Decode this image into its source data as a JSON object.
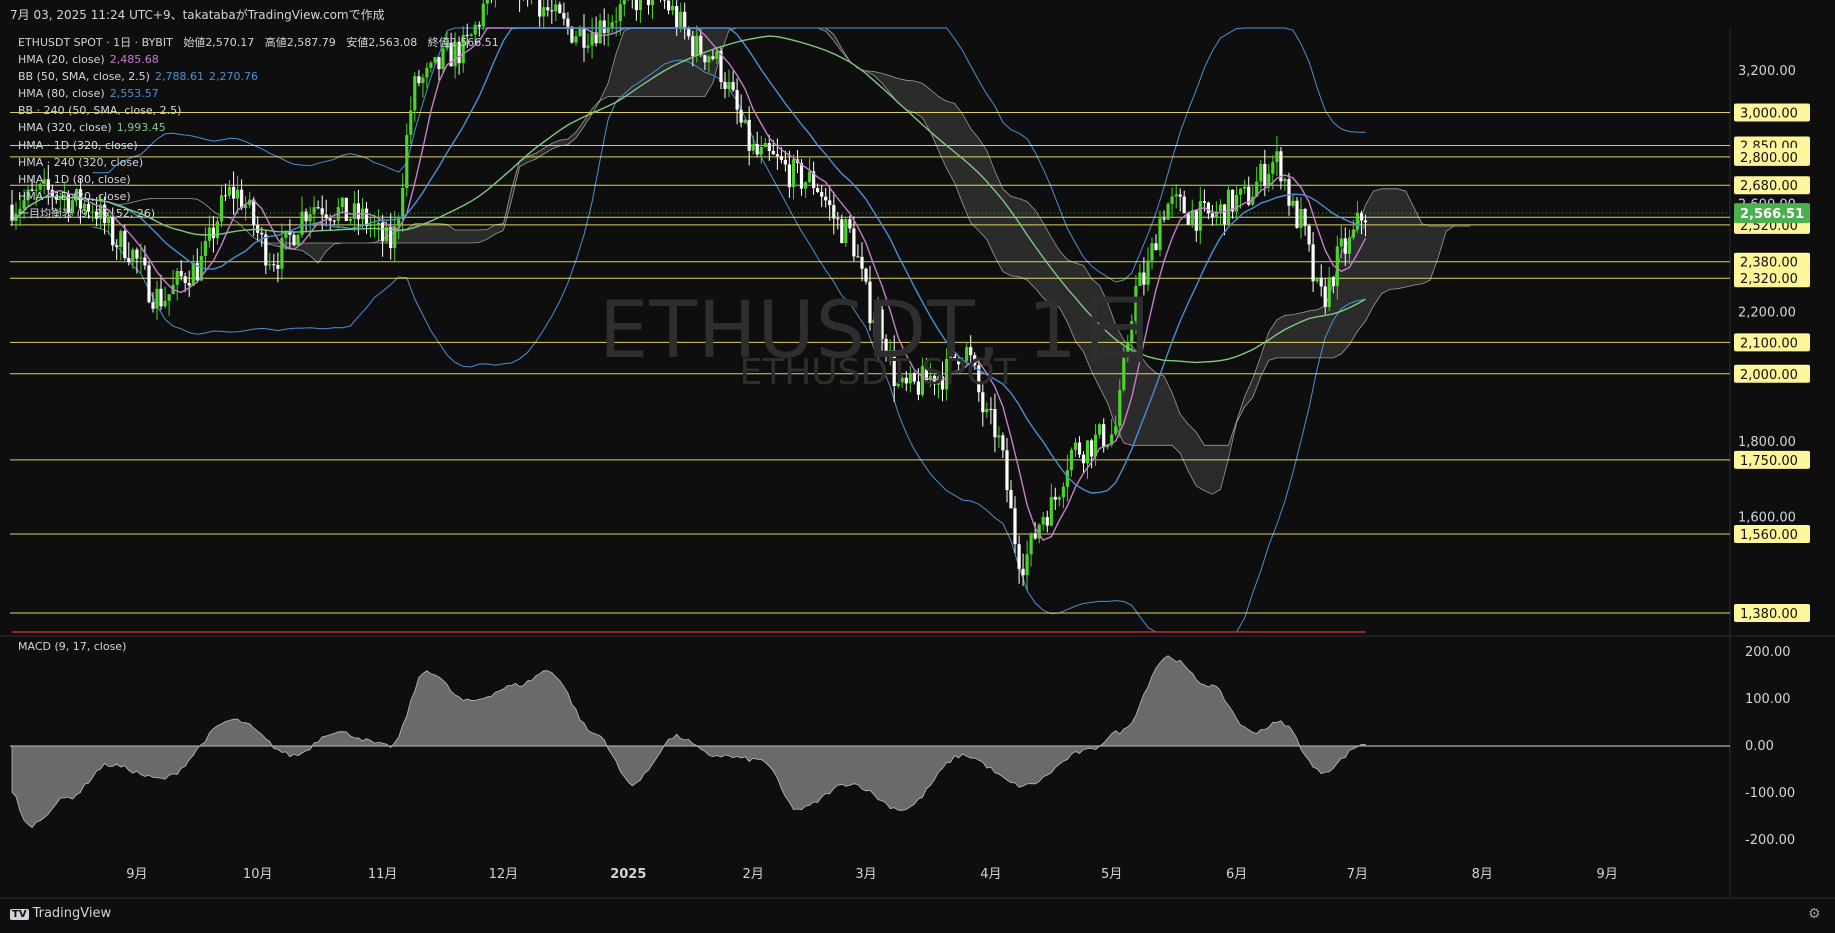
{
  "header": {
    "snapshot_info": "7月 03, 2025 11:24 UTC+9、takatabaがTradingView.comで作成"
  },
  "legend": {
    "symbol": "ETHUSDT SPOT · 1日 · BYBIT",
    "ohlc": [
      {
        "label": "始値",
        "value": "2,570.17"
      },
      {
        "label": "高値",
        "value": "2,587.79"
      },
      {
        "label": "安値",
        "value": "2,563.08"
      },
      {
        "label": "終値",
        "value": "2,566.51"
      }
    ],
    "indicators": [
      {
        "label": "HMA (20, close)",
        "values": [
          "2,485.68"
        ],
        "colors": [
          "#c77dcc"
        ]
      },
      {
        "label": "BB (50, SMA, close, 2.5)",
        "values": [
          "2,788.61",
          "2,270.76"
        ],
        "colors": [
          "#4a8fd6",
          "#4a8fd6"
        ]
      },
      {
        "label": "HMA (80, close)",
        "values": [
          "2,553.57"
        ],
        "colors": [
          "#4a8fd6"
        ]
      },
      {
        "label": "BB · 240 (50, SMA, close, 2.5)",
        "values": [],
        "colors": []
      },
      {
        "label": "HMA (320, close)",
        "values": [
          "1,993.45"
        ],
        "colors": [
          "#7fc97f"
        ]
      },
      {
        "label": "HMA · 1D (320, close)",
        "values": [],
        "colors": []
      },
      {
        "label": "HMA · 240 (320, close)",
        "values": [],
        "colors": []
      },
      {
        "label": "HMA · 1D (80, close)",
        "values": [],
        "colors": []
      },
      {
        "label": "HMA · 1D (20, close)",
        "values": [],
        "colors": []
      },
      {
        "label": "一目均衡表 (9, 26, 52, 26)",
        "values": [],
        "colors": []
      }
    ]
  },
  "watermark": {
    "line1": "ETHUSDT, 1日",
    "line2": "ETHUSDT SPOT"
  },
  "price_axis": {
    "labels": [
      "3,200.00",
      "2,600.00",
      "2,200.00",
      "1,800.00",
      "1,600.00"
    ],
    "level_tags": [
      "3,000.00",
      "2,850.00",
      "2,800.00",
      "2,680.00",
      "2,550.00",
      "2,520.00",
      "2,380.00",
      "2,320.00",
      "2,100.00",
      "2,000.00",
      "1,750.00",
      "1,560.00",
      "1,380.00"
    ],
    "current_price": "2,566.51"
  },
  "macd_panel": {
    "title": "MACD (9, 17, close)",
    "axis_labels": [
      "200.00",
      "100.00",
      "0.00",
      "-100.00",
      "-200.00"
    ]
  },
  "time_axis": {
    "labels": [
      "9月",
      "10月",
      "11月",
      "12月",
      "2025",
      "2月",
      "3月",
      "4月",
      "5月",
      "6月",
      "7月",
      "8月",
      "9月"
    ]
  },
  "colors": {
    "background": "#0e0e0e",
    "up_candle": "#4dd22c",
    "down_candle": "#ffffff",
    "level_line": "#f5e66b",
    "price_tag": "#fff59a",
    "current_price_tag": "#4caf50",
    "hma20": "#c77dcc",
    "hma80": "#4a8fd6",
    "hma320": "#7fc97f",
    "bb": "#4a8fd6",
    "cloud": "#444444",
    "macd_area": "#8a8a8a",
    "signal": "#e53935"
  },
  "branding": {
    "name": "TradingView"
  },
  "chart_data": {
    "type": "candlestick",
    "instrument": "ETHUSDT SPOT · 1日 · BYBIT",
    "x_range": [
      "2024-08-01",
      "2025-09-30"
    ],
    "y_range_log": [
      1340,
      3420
    ],
    "horizontal_levels": [
      3000,
      2850,
      2800,
      2680,
      2550,
      2520,
      2380,
      2320,
      2100,
      2000,
      1750,
      1560,
      1380
    ],
    "price_path": [
      [
        "2024-08-01",
        2600
      ],
      [
        "2024-08-10",
        2650
      ],
      [
        "2024-08-20",
        2600
      ],
      [
        "2024-08-28",
        2450
      ],
      [
        "2024-09-07",
        2250
      ],
      [
        "2024-09-15",
        2350
      ],
      [
        "2024-09-25",
        2650
      ],
      [
        "2024-10-05",
        2400
      ],
      [
        "2024-10-15",
        2600
      ],
      [
        "2024-10-26",
        2550
      ],
      [
        "2024-11-03",
        2450
      ],
      [
        "2024-11-10",
        3150
      ],
      [
        "2024-11-20",
        3300
      ],
      [
        "2024-12-01",
        3700
      ],
      [
        "2024-12-20",
        3400
      ],
      [
        "2025-01-07",
        3600
      ],
      [
        "2025-01-20",
        3300
      ],
      [
        "2025-02-03",
        2800
      ],
      [
        "2025-02-15",
        2700
      ],
      [
        "2025-02-24",
        2500
      ],
      [
        "2025-03-03",
        2200
      ],
      [
        "2025-03-10",
        1950
      ],
      [
        "2025-03-20",
        2000
      ],
      [
        "2025-03-25",
        2080
      ],
      [
        "2025-04-01",
        1850
      ],
      [
        "2025-04-09",
        1500
      ],
      [
        "2025-04-15",
        1620
      ],
      [
        "2025-04-22",
        1780
      ],
      [
        "2025-05-01",
        1820
      ],
      [
        "2025-05-08",
        2300
      ],
      [
        "2025-05-15",
        2600
      ],
      [
        "2025-05-25",
        2550
      ],
      [
        "2025-06-02",
        2620
      ],
      [
        "2025-06-11",
        2780
      ],
      [
        "2025-06-16",
        2550
      ],
      [
        "2025-06-22",
        2250
      ],
      [
        "2025-06-28",
        2430
      ],
      [
        "2025-07-03",
        2566.51
      ]
    ],
    "macd_path": [
      [
        "2024-08-01",
        -100
      ],
      [
        "2024-08-05",
        -170
      ],
      [
        "2024-08-15",
        -110
      ],
      [
        "2024-08-25",
        -40
      ],
      [
        "2024-09-07",
        -70
      ],
      [
        "2024-09-25",
        55
      ],
      [
        "2024-10-10",
        -20
      ],
      [
        "2024-10-20",
        30
      ],
      [
        "2024-11-03",
        0
      ],
      [
        "2024-11-12",
        160
      ],
      [
        "2024-11-22",
        95
      ],
      [
        "2024-12-05",
        130
      ],
      [
        "2024-12-12",
        160
      ],
      [
        "2024-12-24",
        25
      ],
      [
        "2025-01-02",
        -80
      ],
      [
        "2025-01-13",
        20
      ],
      [
        "2025-01-22",
        -20
      ],
      [
        "2025-02-03",
        -30
      ],
      [
        "2025-02-12",
        -135
      ],
      [
        "2025-02-25",
        -80
      ],
      [
        "2025-03-10",
        -135
      ],
      [
        "2025-03-25",
        -20
      ],
      [
        "2025-04-09",
        -85
      ],
      [
        "2025-04-25",
        -10
      ],
      [
        "2025-05-03",
        30
      ],
      [
        "2025-05-15",
        190
      ],
      [
        "2025-05-25",
        130
      ],
      [
        "2025-06-05",
        30
      ],
      [
        "2025-06-12",
        50
      ],
      [
        "2025-06-22",
        -55
      ],
      [
        "2025-07-03",
        5
      ]
    ],
    "macd_range": [
      -240,
      230
    ]
  }
}
